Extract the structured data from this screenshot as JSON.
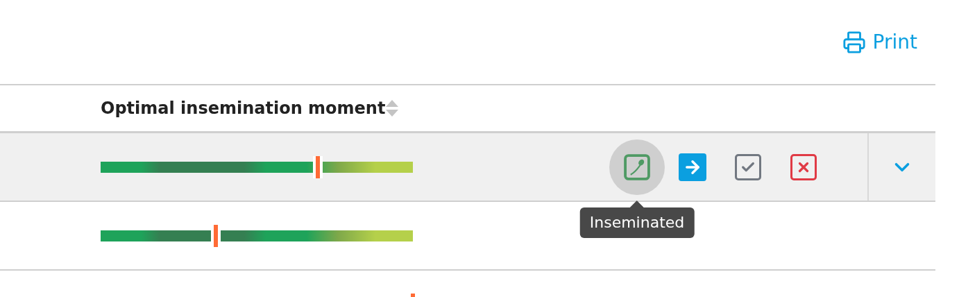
{
  "print_link": {
    "label": "Print"
  },
  "table": {
    "columns": [
      {
        "label": "Optimal insemination moment",
        "sortable": true
      }
    ],
    "rows": [
      {
        "selected": true,
        "level": 0.696,
        "actions": [
          {
            "kind": "inseminated",
            "hovered": true,
            "tooltip": "Inseminated"
          },
          {
            "kind": "forward",
            "hovered": false
          },
          {
            "kind": "done",
            "hovered": false
          },
          {
            "kind": "reject",
            "hovered": false
          }
        ],
        "expandable": true
      },
      {
        "selected": false,
        "level": 0.369
      },
      {
        "selected": false,
        "level": 1.0
      }
    ]
  }
}
